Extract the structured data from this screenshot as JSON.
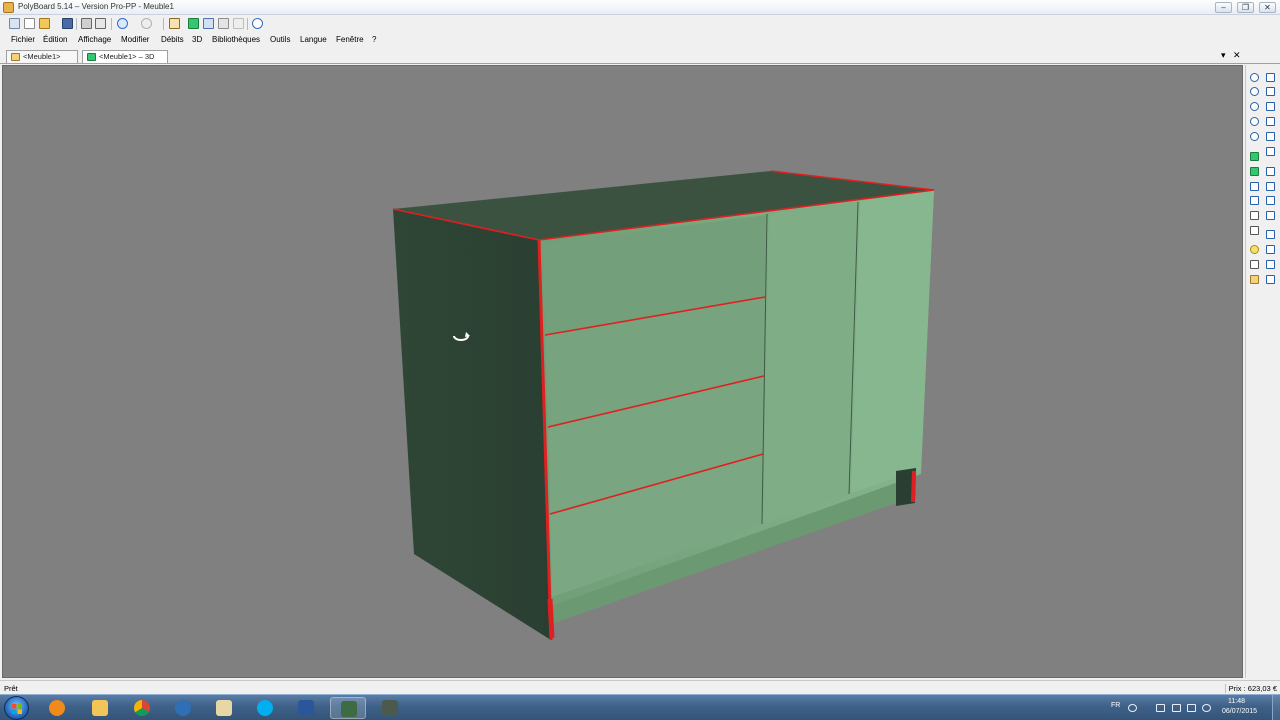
{
  "window": {
    "title": "PolyBoard 5.14 – Version Pro-PP - Meuble1",
    "controls": {
      "minimize": "–",
      "restore": "❐",
      "close": "✕"
    }
  },
  "toolbar": {
    "icons": [
      "new-icon",
      "open-icon",
      "save-icon",
      "print-icon",
      "print-preview-icon",
      "undo-icon",
      "redo-icon",
      "export-icon",
      "view-3d-icon",
      "window-icon",
      "info-icon"
    ]
  },
  "menu": [
    "Fichier",
    "Édition",
    "Affichage",
    "Modifier",
    "Débits",
    "3D",
    "Bibliothèques",
    "Outils",
    "Langue",
    "Fenêtre",
    "?"
  ],
  "tabs": [
    {
      "label": "<Meuble1>"
    },
    {
      "label": "<Meuble1> – 3D"
    }
  ],
  "tabs_controls": {
    "dropdown": "▾",
    "close": "✕"
  },
  "status": {
    "left": "Prêt",
    "right": "Prix : 623,03 €"
  },
  "taskbar": {
    "apps": [
      "windows-explorer",
      "media-player",
      "file-explorer",
      "chrome",
      "thunderbird",
      "calculator",
      "skype",
      "word",
      "polyboard",
      "polyboard-alt"
    ],
    "tray": {
      "language": "FR",
      "time": "11:48",
      "date": "06/07/2015"
    }
  },
  "colors": {
    "viewport_bg": "#808080",
    "cabinet_side": "#2e4434",
    "cabinet_front": "#7aa981",
    "edge_highlight": "#e02020"
  }
}
